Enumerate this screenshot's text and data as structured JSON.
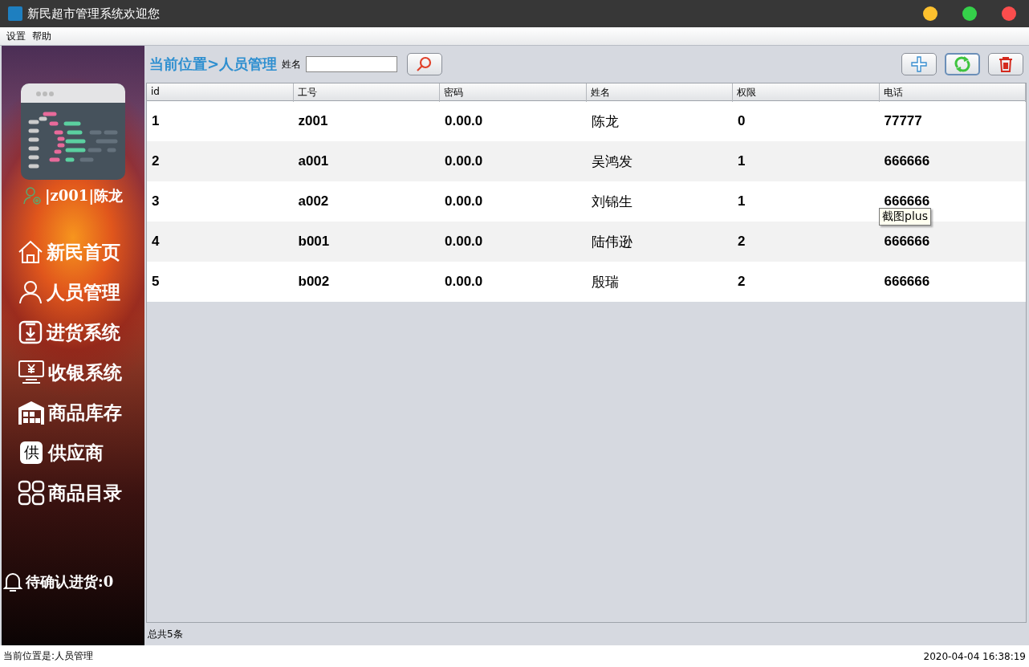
{
  "window": {
    "title": "新民超市管理系统欢迎您"
  },
  "menu": [
    "设置",
    "帮助"
  ],
  "sidebar": {
    "user": "|z001|陈龙",
    "items": [
      {
        "kind": "home",
        "label": "新民首页"
      },
      {
        "kind": "person",
        "label": "人员管理"
      },
      {
        "kind": "download",
        "label": "进货系统"
      },
      {
        "kind": "cashier",
        "label": "收银系统"
      },
      {
        "kind": "warehouse",
        "label": "商品库存"
      },
      {
        "kind": "supplier",
        "label": "供应商",
        "icon_glyph": "供"
      },
      {
        "kind": "grid",
        "label": "商品目录"
      }
    ],
    "notice": "待确认进货:0"
  },
  "toolbar": {
    "breadcrumb": "当前位置>人员管理",
    "search_label": "姓名"
  },
  "table": {
    "columns": [
      "id",
      "工号",
      "密码",
      "姓名",
      "权限",
      "电话"
    ],
    "rows": [
      [
        "1",
        "z001",
        "0.00.0",
        "陈龙",
        "0",
        "77777"
      ],
      [
        "2",
        "a001",
        "0.00.0",
        "吴鸿发",
        "1",
        "666666"
      ],
      [
        "3",
        "a002",
        "0.00.0",
        "刘锦生",
        "1",
        "666666"
      ],
      [
        "4",
        "b001",
        "0.00.0",
        "陆伟逊",
        "2",
        "666666"
      ],
      [
        "5",
        "b002",
        "0.00.0",
        "殷瑞",
        "2",
        "666666"
      ]
    ]
  },
  "tooltip": "截图plus",
  "total": "总共5条",
  "status_bar": {
    "location": "当前位置是:人员管理",
    "datetime": "2020-04-04 16:38:19"
  }
}
